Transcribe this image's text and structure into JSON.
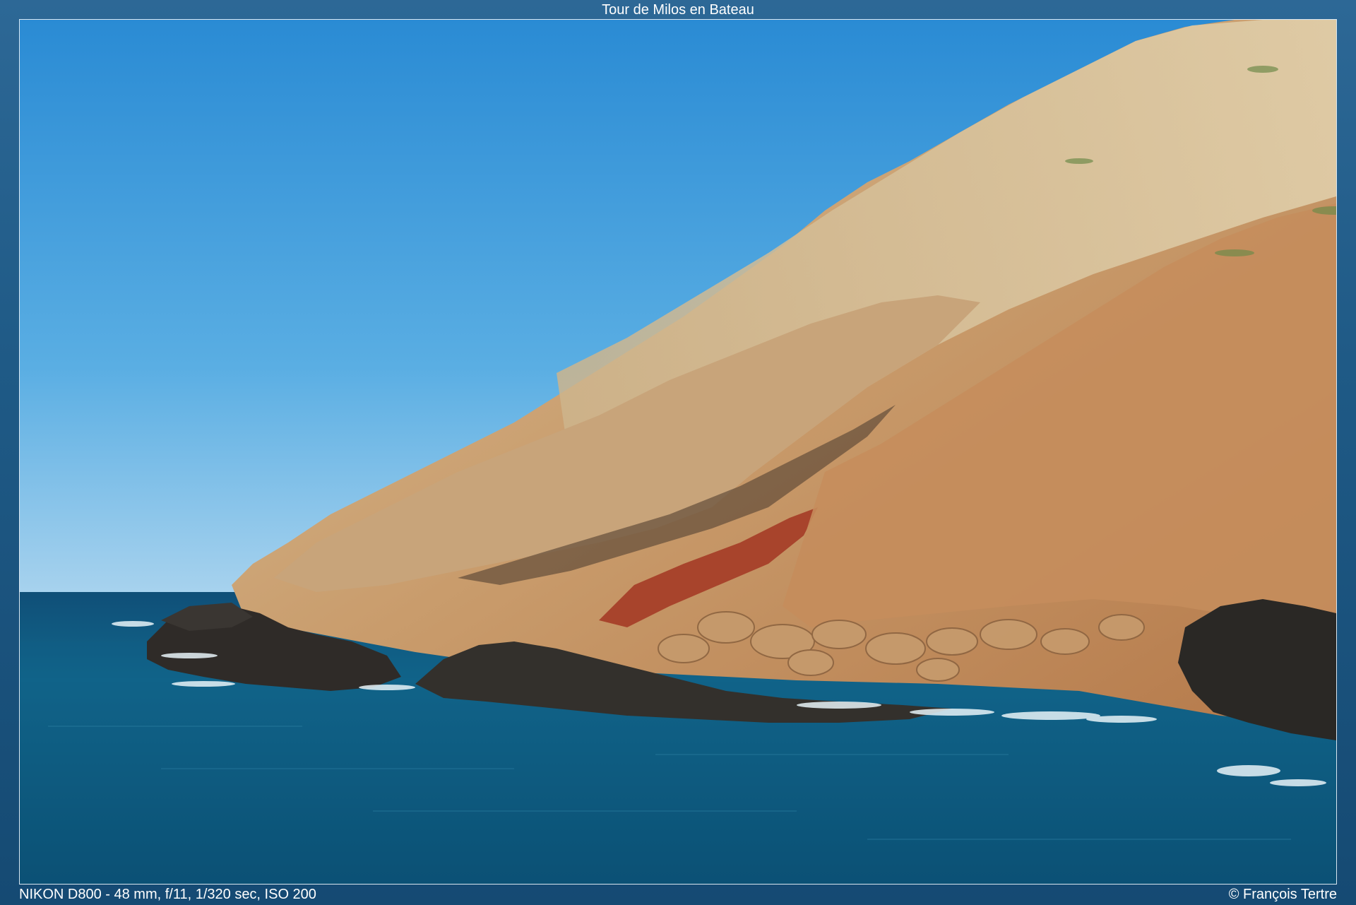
{
  "title": "Tour de Milos en Bateau",
  "exif": "NIKON D800 - 48 mm, f/11, 1/320 sec, ISO 200",
  "copyright": "© François Tertre",
  "colors": {
    "frame": "#1f5a86",
    "sky_top": "#2f8fd6",
    "sky_horizon": "#9fcdeb",
    "sea": "#0d5a7e",
    "cliff": "#c8a074",
    "red_soil": "#a8442c",
    "dark_rock": "#2c2a28"
  }
}
